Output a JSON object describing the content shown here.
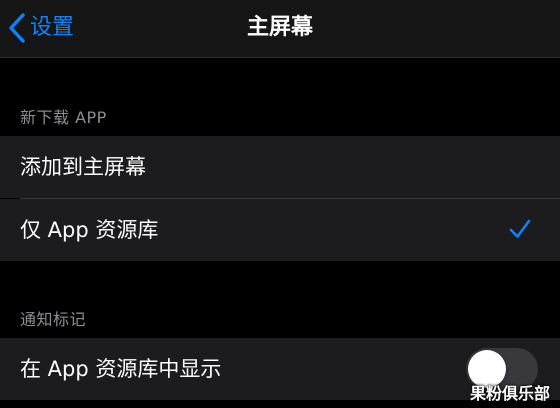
{
  "nav": {
    "back_label": "设置",
    "title": "主屏幕"
  },
  "sections": [
    {
      "header": "新下载 APP",
      "options": [
        {
          "label": "添加到主屏幕",
          "selected": false
        },
        {
          "label": "仅 App 资源库",
          "selected": true
        }
      ]
    },
    {
      "header": "通知标记",
      "toggles": [
        {
          "label": "在 App 资源库中显示",
          "on": false
        }
      ]
    }
  ],
  "watermark": "果粉俱乐部",
  "colors": {
    "accent": "#0a84ff",
    "background": "#000000",
    "cell": "#1c1c1e",
    "secondary_text": "#8d8d93"
  }
}
